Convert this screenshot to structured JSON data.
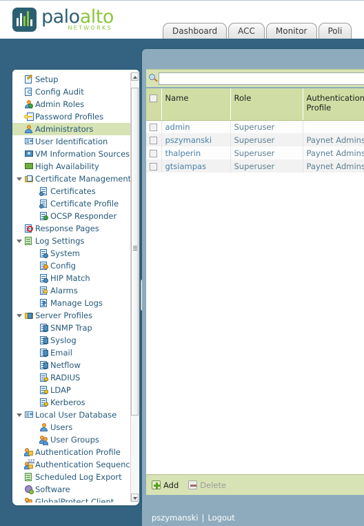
{
  "brand": {
    "name_part1": "palo",
    "name_part2": "alto",
    "tagline": "NETWORKS",
    "primary_color": "#2b5f72",
    "accent_color": "#8cc63e"
  },
  "tabs": [
    {
      "label": "Dashboard",
      "name": "tab-dashboard"
    },
    {
      "label": "ACC",
      "name": "tab-acc"
    },
    {
      "label": "Monitor",
      "name": "tab-monitor"
    },
    {
      "label": "Poli",
      "name": "tab-policies"
    }
  ],
  "sidebar": {
    "selected": "Administrators",
    "items": [
      {
        "label": "Setup",
        "icon": "setup-icon",
        "level": 1,
        "expander": false
      },
      {
        "label": "Config Audit",
        "icon": "config-audit-icon",
        "level": 1,
        "expander": false
      },
      {
        "label": "Admin Roles",
        "icon": "admin-roles-icon",
        "level": 1,
        "expander": false
      },
      {
        "label": "Password Profiles",
        "icon": "password-profiles-icon",
        "level": 1,
        "expander": false
      },
      {
        "label": "Administrators",
        "icon": "administrators-icon",
        "level": 1,
        "expander": false,
        "selected": true
      },
      {
        "label": "User Identification",
        "icon": "user-identification-icon",
        "level": 1,
        "expander": false
      },
      {
        "label": "VM Information Sources",
        "icon": "vm-information-sources-icon",
        "level": 1,
        "expander": false
      },
      {
        "label": "High Availability",
        "icon": "high-availability-icon",
        "level": 1,
        "expander": false
      },
      {
        "label": "Certificate Management",
        "icon": "certificate-management-icon",
        "level": 1,
        "expander": true
      },
      {
        "label": "Certificates",
        "icon": "certificates-icon",
        "level": 2,
        "expander": false
      },
      {
        "label": "Certificate Profile",
        "icon": "certificate-profile-icon",
        "level": 2,
        "expander": false
      },
      {
        "label": "OCSP Responder",
        "icon": "ocsp-responder-icon",
        "level": 2,
        "expander": false
      },
      {
        "label": "Response Pages",
        "icon": "response-pages-icon",
        "level": 1,
        "expander": false
      },
      {
        "label": "Log Settings",
        "icon": "log-settings-icon",
        "level": 1,
        "expander": true
      },
      {
        "label": "System",
        "icon": "system-icon",
        "level": 2,
        "expander": false
      },
      {
        "label": "Config",
        "icon": "config-icon",
        "level": 2,
        "expander": false
      },
      {
        "label": "HIP Match",
        "icon": "hip-match-icon",
        "level": 2,
        "expander": false
      },
      {
        "label": "Alarms",
        "icon": "alarms-icon",
        "level": 2,
        "expander": false
      },
      {
        "label": "Manage Logs",
        "icon": "manage-logs-icon",
        "level": 2,
        "expander": false
      },
      {
        "label": "Server Profiles",
        "icon": "server-profiles-icon",
        "level": 1,
        "expander": true
      },
      {
        "label": "SNMP Trap",
        "icon": "snmp-trap-icon",
        "level": 2,
        "expander": false
      },
      {
        "label": "Syslog",
        "icon": "syslog-icon",
        "level": 2,
        "expander": false
      },
      {
        "label": "Email",
        "icon": "email-icon",
        "level": 2,
        "expander": false
      },
      {
        "label": "Netflow",
        "icon": "netflow-icon",
        "level": 2,
        "expander": false
      },
      {
        "label": "RADIUS",
        "icon": "radius-icon",
        "level": 2,
        "expander": false
      },
      {
        "label": "LDAP",
        "icon": "ldap-icon",
        "level": 2,
        "expander": false
      },
      {
        "label": "Kerberos",
        "icon": "kerberos-icon",
        "level": 2,
        "expander": false
      },
      {
        "label": "Local User Database",
        "icon": "local-user-database-icon",
        "level": 1,
        "expander": true
      },
      {
        "label": "Users",
        "icon": "users-icon",
        "level": 2,
        "expander": false
      },
      {
        "label": "User Groups",
        "icon": "user-groups-icon",
        "level": 2,
        "expander": false
      },
      {
        "label": "Authentication Profile",
        "icon": "authentication-profile-icon",
        "level": 1,
        "expander": false
      },
      {
        "label": "Authentication Sequence",
        "icon": "authentication-sequence-icon",
        "level": 1,
        "expander": false
      },
      {
        "label": "Scheduled Log Export",
        "icon": "scheduled-log-export-icon",
        "level": 1,
        "expander": false
      },
      {
        "label": "Software",
        "icon": "software-icon",
        "level": 1,
        "expander": false
      },
      {
        "label": "GlobalProtect Client",
        "icon": "globalprotect-client-icon",
        "level": 1,
        "expander": false
      }
    ]
  },
  "search": {
    "value": "",
    "placeholder": "",
    "icon": "search-icon"
  },
  "table": {
    "columns": [
      "Name",
      "Role",
      "Authentication Profile"
    ],
    "rows": [
      {
        "name": "admin",
        "role": "Superuser",
        "auth_profile": ""
      },
      {
        "name": "pszymanski",
        "role": "Superuser",
        "auth_profile": "Paynet Admins"
      },
      {
        "name": "thalperin",
        "role": "Superuser",
        "auth_profile": "Paynet Admins"
      },
      {
        "name": "gtsiampas",
        "role": "Superuser",
        "auth_profile": "Paynet Admins"
      }
    ]
  },
  "toolbar": {
    "add_label": "Add",
    "delete_label": "Delete",
    "delete_disabled": true
  },
  "statusbar": {
    "user": "pszymanski",
    "separator": "|",
    "logout_label": "Logout"
  }
}
